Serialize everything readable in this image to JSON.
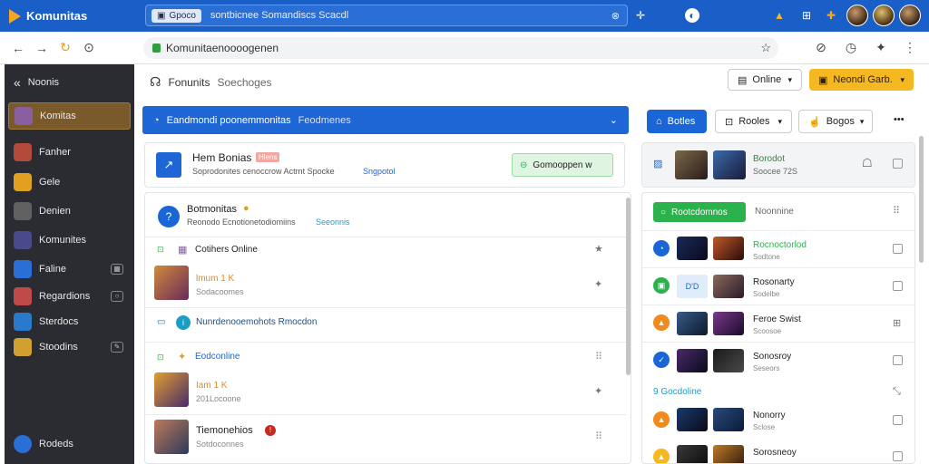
{
  "app": {
    "title": "Komunitas"
  },
  "tabbar": {
    "chip_label": "Gpoco",
    "url": "sontbicnee Somandiscs Scacdl",
    "close": "⊗"
  },
  "address": {
    "url": "Komunitaenoooogenen"
  },
  "sidebar": {
    "header": "Noonis",
    "items": [
      {
        "label": "Komitas",
        "color": "#8a5fa0"
      },
      {
        "label": "Fanher",
        "color": "#b34a3a"
      },
      {
        "label": "Gele",
        "color": "#e0a020"
      },
      {
        "label": "Denien",
        "color": "#606060"
      },
      {
        "label": "Komunites",
        "color": "#4a4a8a"
      },
      {
        "label": "Faline",
        "color": "#2a6fd6"
      },
      {
        "label": "Regardions",
        "color": "#c04a4a"
      },
      {
        "label": "Sterdocs",
        "color": "#2a7acc"
      },
      {
        "label": "Stoodins",
        "color": "#d0a030"
      }
    ],
    "footer": "Rodeds"
  },
  "crumb": {
    "title": "Fonunits",
    "sub": "Soechoges"
  },
  "header_buttons": {
    "online": "Online",
    "primary": "Neondi Garb."
  },
  "banner": {
    "text": "Eandmondi poonemmonitas",
    "sub": "Feodmenes"
  },
  "card": {
    "title": "Hem Bonias",
    "tag": "Hlens",
    "sub": "Soprodonites cenoccrow Actrnt Spocke",
    "link": "Sngpotol",
    "button": "Gomooppen w"
  },
  "feed": {
    "post1": {
      "title": "Botmonitas",
      "sub": "Reonodo Ecnotionetodiomiins",
      "link": "Seeonnis"
    },
    "sec1": {
      "label": "Cotihers Online"
    },
    "item1": {
      "name": "lmum 1 K",
      "meta": "Sodacoomes"
    },
    "post2": {
      "text": "Nunrdenooemohots Rmocdon"
    },
    "sec2": {
      "label": "Eodconline"
    },
    "item2": {
      "name": "Iam 1 K",
      "meta": "201Locoone"
    },
    "item3": {
      "name": "Tiemonehios",
      "meta": "Sotdoconnes"
    }
  },
  "rpanel": {
    "btn1": "Botles",
    "btn2": "Rooles",
    "btn3": "Bogos",
    "more": "•••",
    "card": {
      "title": "Borodot",
      "sub": "Soocee 72S"
    },
    "tab_green": "Rootcdomnos",
    "tab_other": "Noonnine",
    "rows": [
      {
        "title": "Rocnoctorlod",
        "sub": "Sodtone",
        "color": "#1a66d6"
      },
      {
        "title": "Rosonarty",
        "sub": "Sodelbe",
        "color": "#2bb24c",
        "badge": "D'D"
      },
      {
        "title": "Feroe Swist",
        "sub": "Scoosoe",
        "color": "#f08a1d"
      },
      {
        "title": "Sonosroy",
        "sub": "Seseors",
        "color": "#1a66d6"
      }
    ],
    "sec": "9 Gocdoline",
    "rows2": [
      {
        "title": "Nonorry",
        "sub": "Sclose",
        "color": "#f08a1d"
      },
      {
        "title": "Sorosneoy",
        "sub": "",
        "color": "#f6b820"
      }
    ]
  },
  "colors": {
    "brand": "#1a5ec8",
    "accent": "#f6b820",
    "green": "#2bb24c"
  }
}
